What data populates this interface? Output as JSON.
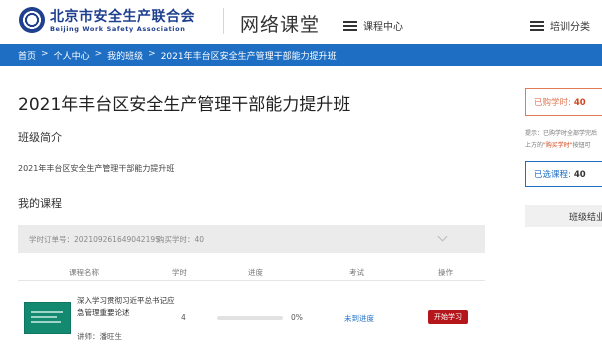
{
  "header": {
    "logo_cn": "北京市安全生产联合会",
    "logo_en": "Beijing Work Safety Association",
    "site_title": "网络课堂",
    "nav": [
      {
        "label": "课程中心",
        "icon": "menu-icon"
      },
      {
        "label": "培训分类",
        "icon": "menu-icon"
      }
    ]
  },
  "breadcrumb": [
    "首页",
    "个人中心",
    "我的班级",
    "2021年丰台区安全生产管理干部能力提升班"
  ],
  "breadcrumb_separator": ">",
  "class": {
    "title": "2021年丰台区安全生产管理干部能力提升班",
    "intro_heading": "班级简介",
    "intro_text": "2021年丰台区安全生产管理干部能力提升班",
    "courses_heading": "我的课程"
  },
  "order": {
    "order_no": "学时订单号：20210926164904219S",
    "hours": "购买学时：40"
  },
  "table": {
    "headers": [
      "课程名称",
      "学时",
      "进度",
      "考试",
      "操作"
    ],
    "rows": [
      {
        "name": "深入学习贯彻习近平总书记应急管理重要论述",
        "teacher": "讲师：潘旺生",
        "hours": "4",
        "progress_value": 0,
        "progress_text": "0%",
        "exam": "未到进度",
        "action": "开始学习"
      }
    ]
  },
  "sidebar": {
    "purchased_label": "已购学时:",
    "purchased_value": "40",
    "hint_line1": "提示：已购学时全部学完后",
    "hint_line2_prefix": "上方的",
    "hint_line2_link": "\"购买学时\"",
    "hint_line2_suffix": "按钮可",
    "selected_label": "已选课程:",
    "selected_value": "40",
    "class_tab": "班级结业"
  },
  "colors": {
    "brand_blue": "#1e6fc4",
    "logo_blue": "#1f3f8f",
    "action_red": "#b5161b",
    "accent_orange": "#e07a58"
  }
}
